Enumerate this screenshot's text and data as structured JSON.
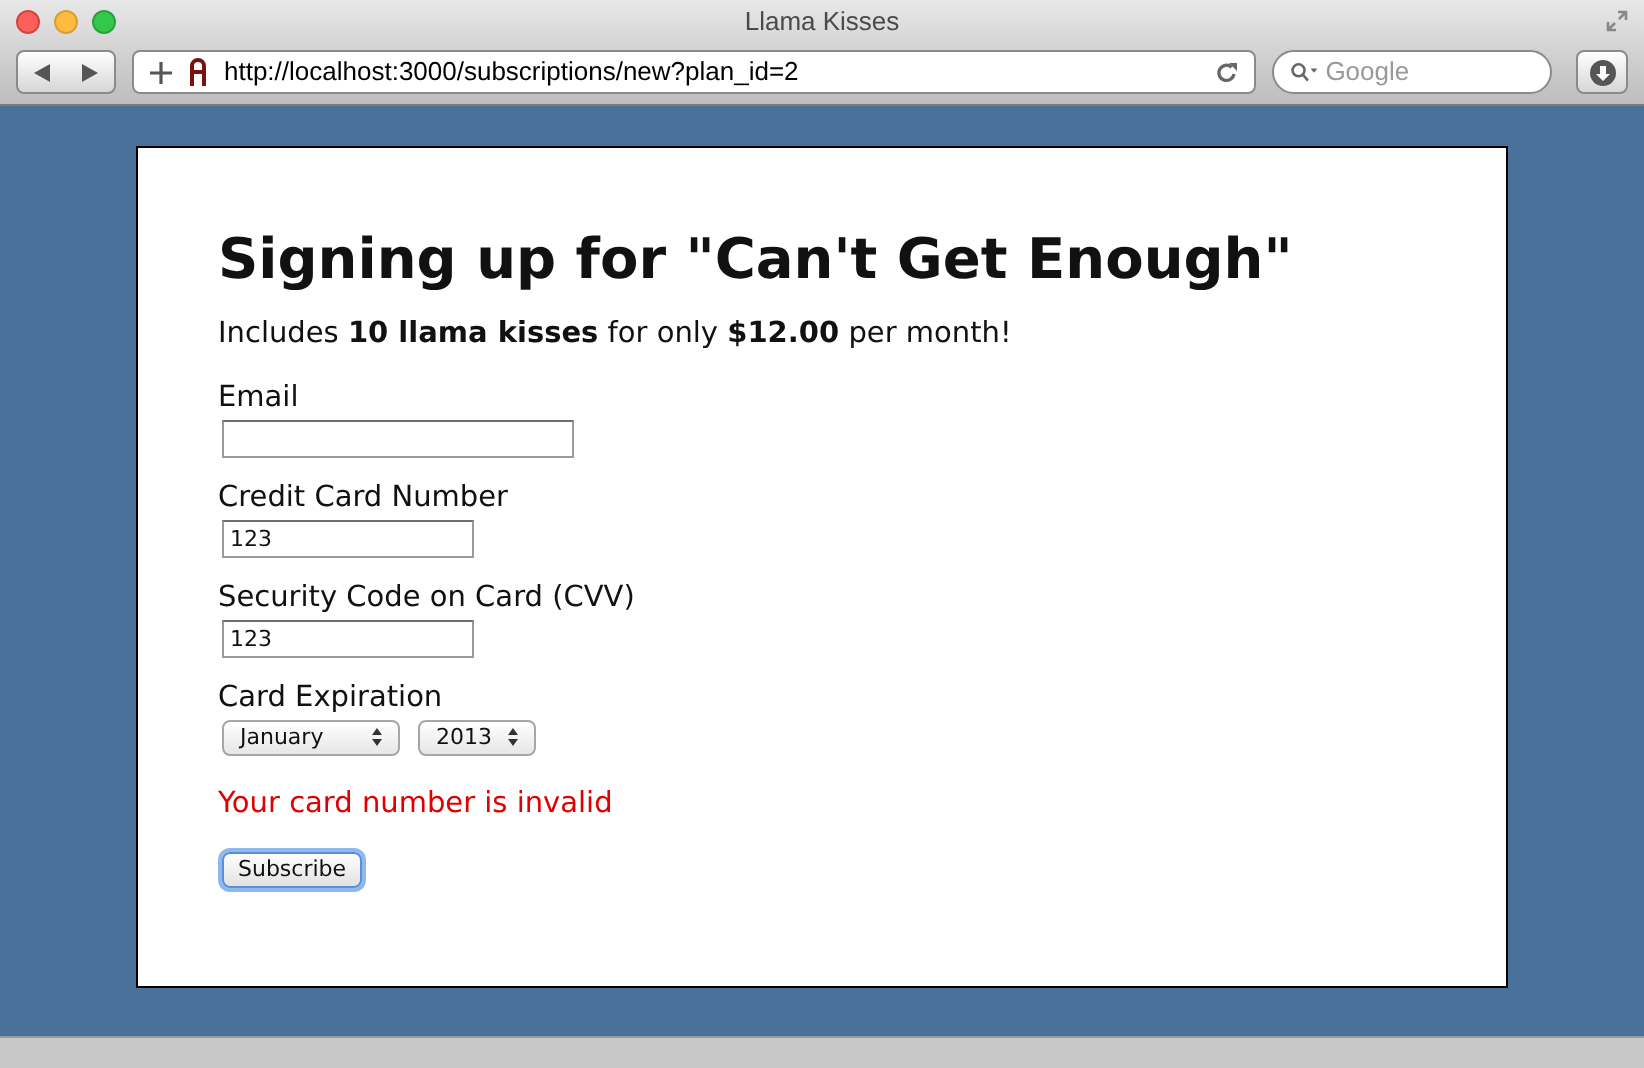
{
  "window": {
    "title": "Llama Kisses"
  },
  "toolbar": {
    "url": "http://localhost:3000/subscriptions/new?plan_id=2",
    "search": {
      "placeholder": "Google"
    }
  },
  "page": {
    "heading": "Signing up for \"Can't Get Enough\"",
    "description": "Includes **10 llama kisses** for only **$12.00** per month!",
    "fields": [
      {
        "kind": "text",
        "label": "Email"
      },
      {
        "kind": "text",
        "label": "Credit Card Number",
        "value": "123"
      },
      {
        "kind": "text",
        "label": "Security Code on Card (CVV)",
        "value": "123"
      },
      {
        "kind": "selects",
        "label": "Card Expiration",
        "selects": [
          "January",
          "2013"
        ]
      }
    ],
    "error": "Your card number is invalid",
    "submit": {
      "label": "Subscribe",
      "focused": true
    }
  }
}
